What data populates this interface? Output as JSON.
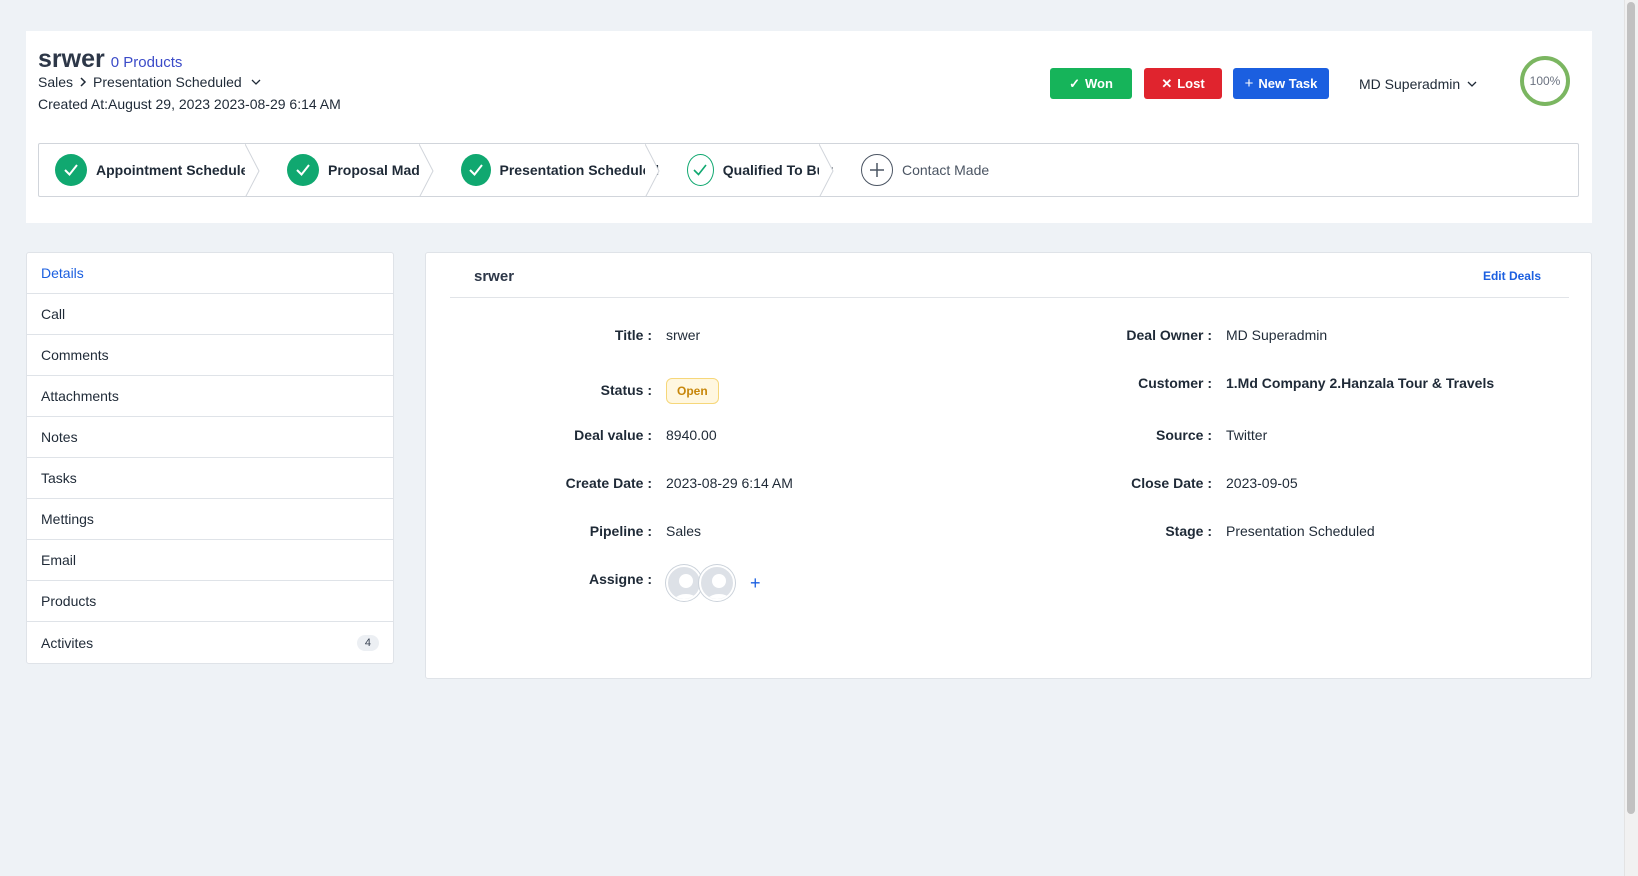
{
  "deal": {
    "name": "srwer",
    "products_link": "0 Products",
    "breadcrumb_pipeline": "Sales",
    "breadcrumb_stage": "Presentation Scheduled",
    "created_at": "Created At:August 29, 2023 2023-08-29 6:14 AM"
  },
  "actions": {
    "won_label": "Won",
    "lost_label": "Lost",
    "new_task_label": "New Task",
    "owner_label": "MD Superadmin",
    "progress_text": "100%",
    "progress_value": 100
  },
  "stages": [
    {
      "label": "Appointment Scheduled",
      "state": "done"
    },
    {
      "label": "Proposal Made",
      "state": "done"
    },
    {
      "label": "Presentation Scheduled",
      "state": "done"
    },
    {
      "label": "Qualified To Buy",
      "state": "current"
    },
    {
      "label": "Contact Made",
      "state": "pending"
    }
  ],
  "sidebar": {
    "items": [
      {
        "label": "Details",
        "active": true
      },
      {
        "label": "Call"
      },
      {
        "label": "Comments"
      },
      {
        "label": "Attachments"
      },
      {
        "label": "Notes"
      },
      {
        "label": "Tasks"
      },
      {
        "label": "Mettings"
      },
      {
        "label": "Email"
      },
      {
        "label": "Products"
      },
      {
        "label": "Activites",
        "count": "4"
      }
    ]
  },
  "details": {
    "title": "srwer",
    "edit_label": "Edit Deals",
    "left": {
      "title_key": "Title :",
      "title_val": "srwer",
      "status_key": "Status :",
      "status_val": "Open",
      "deal_value_key": "Deal value :",
      "deal_value_val": "8940.00",
      "create_date_key": "Create Date :",
      "create_date_val": "2023-08-29 6:14 AM",
      "pipeline_key": "Pipeline :",
      "pipeline_val": "Sales",
      "assigne_key": "Assigne :"
    },
    "right": {
      "owner_key": "Deal Owner :",
      "owner_val": "MD Superadmin",
      "customer_key": "Customer :",
      "customer_val": "1.Md Company 2.Hanzala Tour & Travels",
      "source_key": "Source :",
      "source_val": "Twitter",
      "close_date_key": "Close Date :",
      "close_date_val": "2023-09-05",
      "stage_key": "Stage :",
      "stage_val": "Presentation Scheduled"
    }
  },
  "colors": {
    "won": "#16b45a",
    "lost": "#e0242e",
    "primary": "#1b5fe0",
    "stage_done": "#10a870",
    "progress": "#7bb661"
  }
}
